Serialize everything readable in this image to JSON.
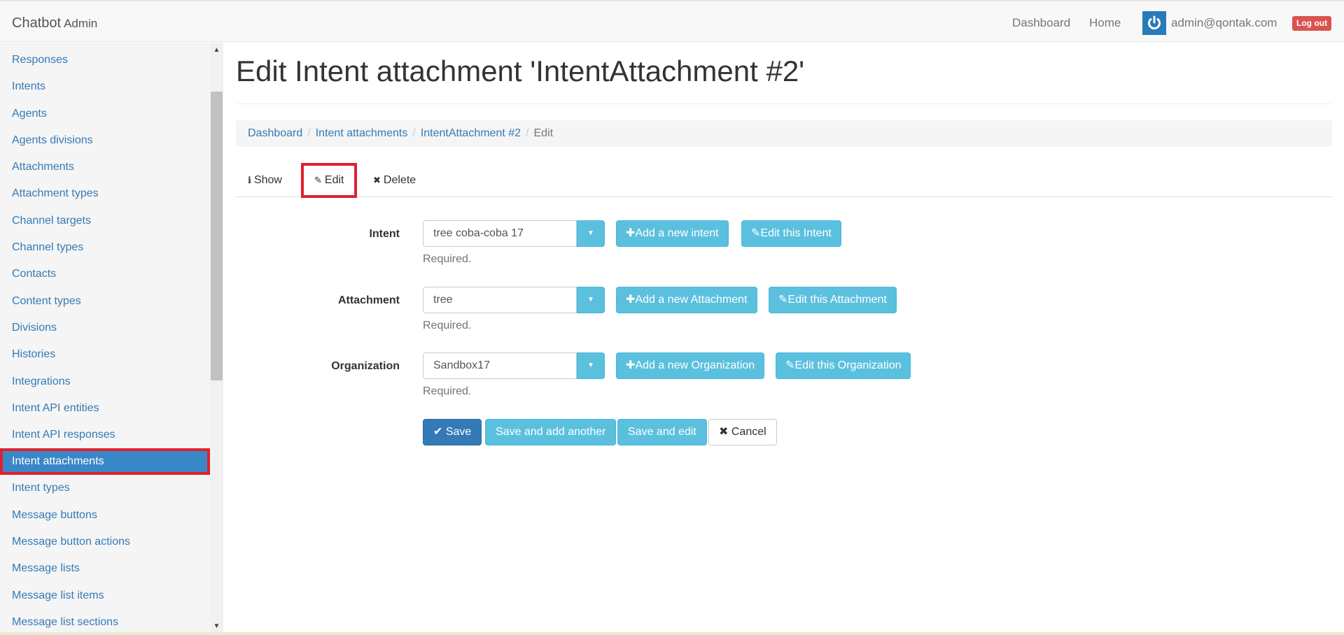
{
  "navbar": {
    "brand": "Chatbot",
    "brand_sub": "Admin",
    "links": [
      "Dashboard",
      "Home"
    ],
    "user_email": "admin@qontak.com",
    "logout_label": "Log out"
  },
  "sidebar": {
    "items": [
      "Responses",
      "Intents",
      "Agents",
      "Agents divisions",
      "Attachments",
      "Attachment types",
      "Channel targets",
      "Channel types",
      "Contacts",
      "Content types",
      "Divisions",
      "Histories",
      "Integrations",
      "Intent API entities",
      "Intent API responses",
      "Intent attachments",
      "Intent types",
      "Message buttons",
      "Message button actions",
      "Message lists",
      "Message list items",
      "Message list sections"
    ],
    "active_item": "Intent attachments"
  },
  "page": {
    "title": "Edit Intent attachment 'IntentAttachment #2'"
  },
  "breadcrumb": {
    "items": [
      "Dashboard",
      "Intent attachments",
      "IntentAttachment #2"
    ],
    "current": "Edit"
  },
  "tabs": {
    "show": "Show",
    "edit": "Edit",
    "delete": "Delete"
  },
  "form": {
    "intent": {
      "label": "Intent",
      "value": "tree coba-coba 17",
      "help": "Required.",
      "add_label": "Add a new intent",
      "edit_label": "Edit this Intent"
    },
    "attachment": {
      "label": "Attachment",
      "value": "tree",
      "help": "Required.",
      "add_label": "Add a new Attachment",
      "edit_label": "Edit this Attachment"
    },
    "organization": {
      "label": "Organization",
      "value": "Sandbox17",
      "help": "Required.",
      "add_label": "Add a new Organization",
      "edit_label": "Edit this Organization"
    }
  },
  "actions": {
    "save": "Save",
    "save_add": "Save and add another",
    "save_edit": "Save and edit",
    "cancel": "Cancel"
  },
  "colors": {
    "primary": "#337ab7",
    "info": "#5bc0de",
    "danger": "#d9534f",
    "highlight": "#e1202b",
    "sidebar_active": "#3a87c8"
  }
}
